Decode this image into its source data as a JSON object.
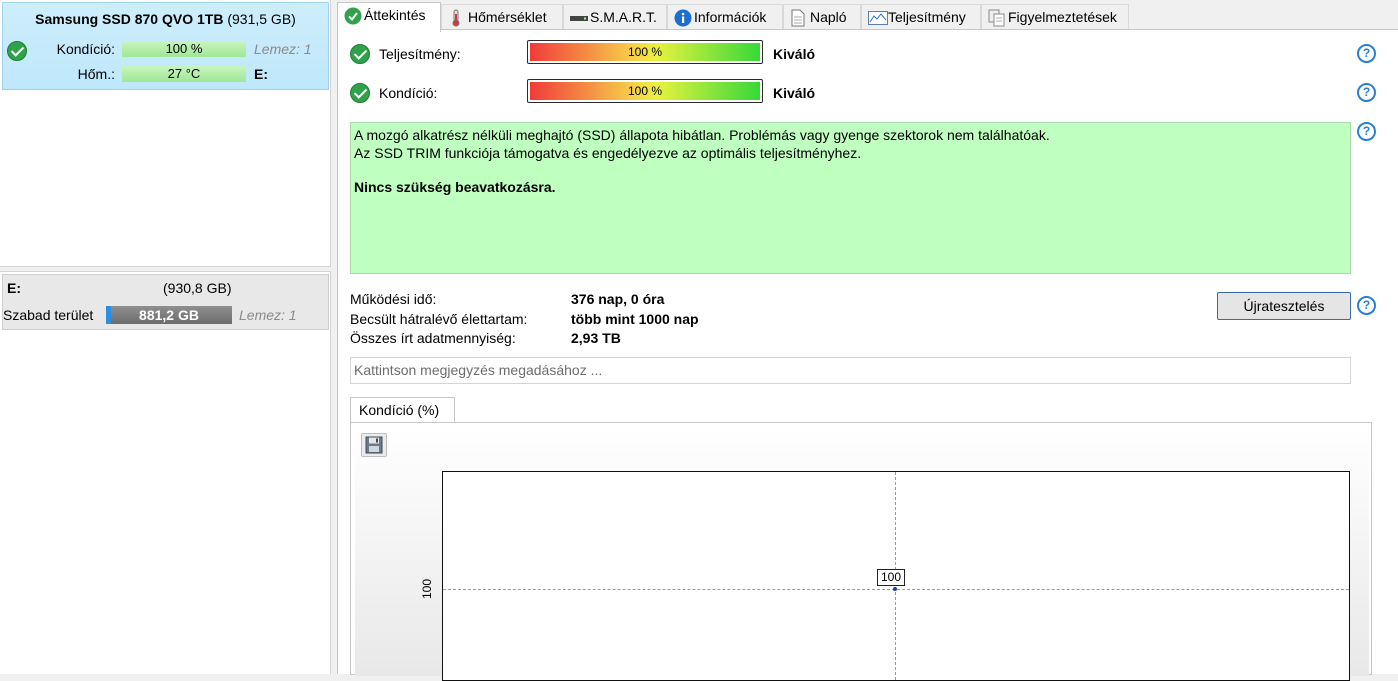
{
  "left_panel": {
    "disk": {
      "name": "Samsung SSD 870 QVO 1TB",
      "size": "(931,5 GB)",
      "health_label": "Kondíció:",
      "health_value": "100 %",
      "health_disk_ref": "Lemez: 1",
      "temp_label": "Hőm.:",
      "temp_value": "27 °C",
      "drive_letter": "E:"
    },
    "partition": {
      "letter": "E:",
      "size": "(930,8 GB)",
      "free_label": "Szabad terület",
      "free_value": "881,2 GB",
      "free_fraction": 0.947,
      "disk_ref": "Lemez: 1"
    }
  },
  "tabs": [
    {
      "label": "Áttekintés",
      "icon": "check-icon",
      "active": true
    },
    {
      "label": "Hőmérséklet",
      "icon": "thermometer-icon",
      "active": false
    },
    {
      "label": "S.M.A.R.T.",
      "icon": "drive-icon",
      "active": false
    },
    {
      "label": "Információk",
      "icon": "info-icon",
      "active": false
    },
    {
      "label": "Napló",
      "icon": "document-icon",
      "active": false
    },
    {
      "label": "Teljesítmény",
      "icon": "performance-chart-icon",
      "active": false
    },
    {
      "label": "Figyelmeztetések",
      "icon": "alerts-icon",
      "active": false
    }
  ],
  "overview": {
    "performance": {
      "label": "Teljesítmény:",
      "value": "100 %",
      "level": 1.0,
      "rating": "Kiváló"
    },
    "health": {
      "label": "Kondíció:",
      "value": "100 %",
      "level": 1.0,
      "rating": "Kiváló"
    },
    "status_lines": [
      "A mozgó alkatrész nélküli meghajtó (SSD) állapota hibátlan. Problémás vagy gyenge szektorok nem találhatóak.",
      "Az SSD TRIM funkciója támogatva és engedélyezve az optimális teljesítményhez."
    ],
    "status_action": "Nincs szükség beavatkozásra.",
    "power_on_label": "Működési idő:",
    "power_on_value": "376 nap, 0 óra",
    "lifetime_label": "Becsült hátralévő élettartam:",
    "lifetime_value": "több mint 1000 nap",
    "written_label": "Összes írt adatmennyiség:",
    "written_value": "2,93 TB",
    "retest_label": "Újratesztelés",
    "note_placeholder": "Kattintson megjegyzés megadásához ...",
    "chart_tab_label": "Kondíció  (%)"
  },
  "chart_data": {
    "type": "line",
    "title": "",
    "xlabel": "",
    "ylabel": "",
    "y_ticks": [
      "100"
    ],
    "series": [
      {
        "values": [
          100
        ]
      }
    ],
    "point_labels": [
      "100"
    ],
    "grid": true,
    "point_color": "#1a3fb0"
  }
}
